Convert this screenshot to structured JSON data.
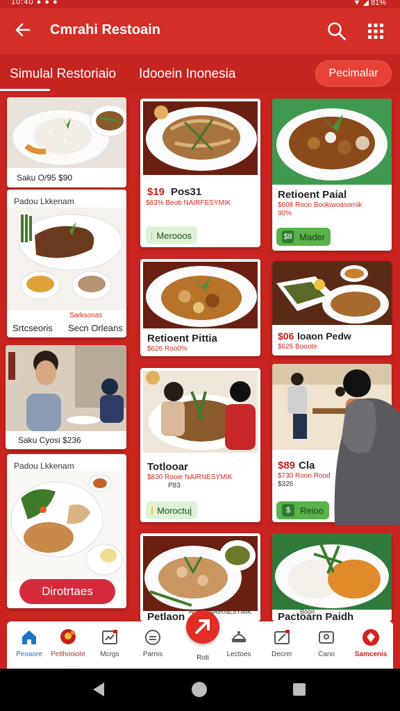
{
  "status": {
    "left": "10:40 ● ● ●",
    "right": "▼ ◢ 81%"
  },
  "appbar": {
    "title": "Cmrahi Restoain"
  },
  "tabs": {
    "tab1": "Simulal Restoriaio",
    "tab2": "Idooein Inonesia",
    "promo": "Pecimalar"
  },
  "col1": {
    "card1": {
      "caption": "Saku   O/95    $90"
    },
    "card2": {
      "header": "Padou Lkkenam",
      "left": "Srtcseoris",
      "left_top": "Sarksonas",
      "right": "Secn Orleans"
    },
    "card3": {
      "caption": "Saku   Cyosi    $236"
    },
    "card4": {
      "header": "Padou Lkkenam",
      "button": "Dirotrtaes"
    }
  },
  "col2": {
    "card1": {
      "price": "$19",
      "name": "Pos31",
      "sub": "$63%  Beob NAIRFESYMIK",
      "pill": "Merooos"
    },
    "card2": {
      "title": "Retioent Pittia",
      "sub": "$626  Roo0%"
    },
    "card3": {
      "title": "Totlooar",
      "sub": "$830  Rooie NAIRNESYMIK",
      "sub2": "P83",
      "pill": "Moroctuj"
    },
    "card4": {
      "title": "Petlaon",
      "sub": "Aoeorl NAIRNESYMIK"
    }
  },
  "col3": {
    "card1": {
      "title": "Retioent Paial",
      "sub": "$608  Roon Bookiwoasomik",
      "sub2": "90%",
      "pill": "Mader",
      "pill_badge": "$8"
    },
    "card2": {
      "price": "$06",
      "name": "loaon Pedw",
      "sub": "$626  Booote"
    },
    "card3": {
      "price": "$89",
      "name": "Cla",
      "sub": "$730  Roon Rood",
      "sub2": "$326",
      "pill": "Reioo"
    },
    "card4": {
      "title": "Pactoarn Paidh",
      "sub": "Boon"
    }
  },
  "bottomnav": {
    "items": [
      "Peoaore",
      "Petlhooiote",
      "Mcrgs",
      "Parnis",
      "Roti",
      "Lectoes",
      "Decrer",
      "Cano",
      "Samcenis"
    ]
  },
  "colors": {
    "primary": "#d42f27",
    "background": "#c9241f",
    "accent_blue": "#1e73c9"
  }
}
